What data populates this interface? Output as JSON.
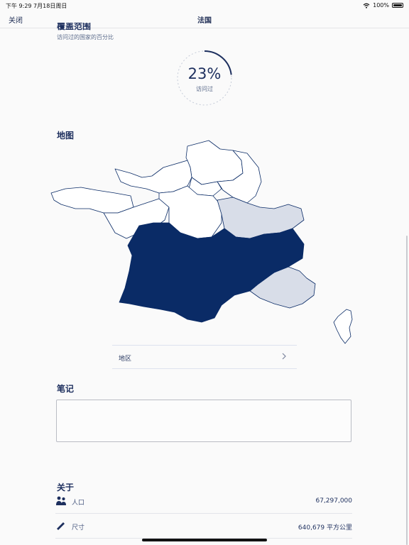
{
  "status_bar": {
    "time": "下午 9:29   7月18日周日",
    "battery": "100%"
  },
  "nav": {
    "close": "关闭",
    "title": "法国"
  },
  "coverage": {
    "title": "覆盖范围",
    "subtitle": "访问过的国家的百分比",
    "percent_label": "23%",
    "ring_label": "访问过",
    "percent": 23
  },
  "map_section": {
    "title": "地图",
    "regions_label": "地区"
  },
  "notes": {
    "title": "笔记",
    "text": ""
  },
  "about": {
    "title": "关于",
    "population_label": "人口",
    "population_value": "67,297,000",
    "size_label": "尺寸",
    "size_value": "640,679 平方公里"
  },
  "colors": {
    "visited": "#0a2b66",
    "partial": "#d8dde8",
    "outline": "#0a2b66",
    "accent": "#1d2f5e"
  },
  "icons": [
    "wifi-icon",
    "battery-icon",
    "chevron-right-icon",
    "people-icon",
    "ruler-icon"
  ]
}
